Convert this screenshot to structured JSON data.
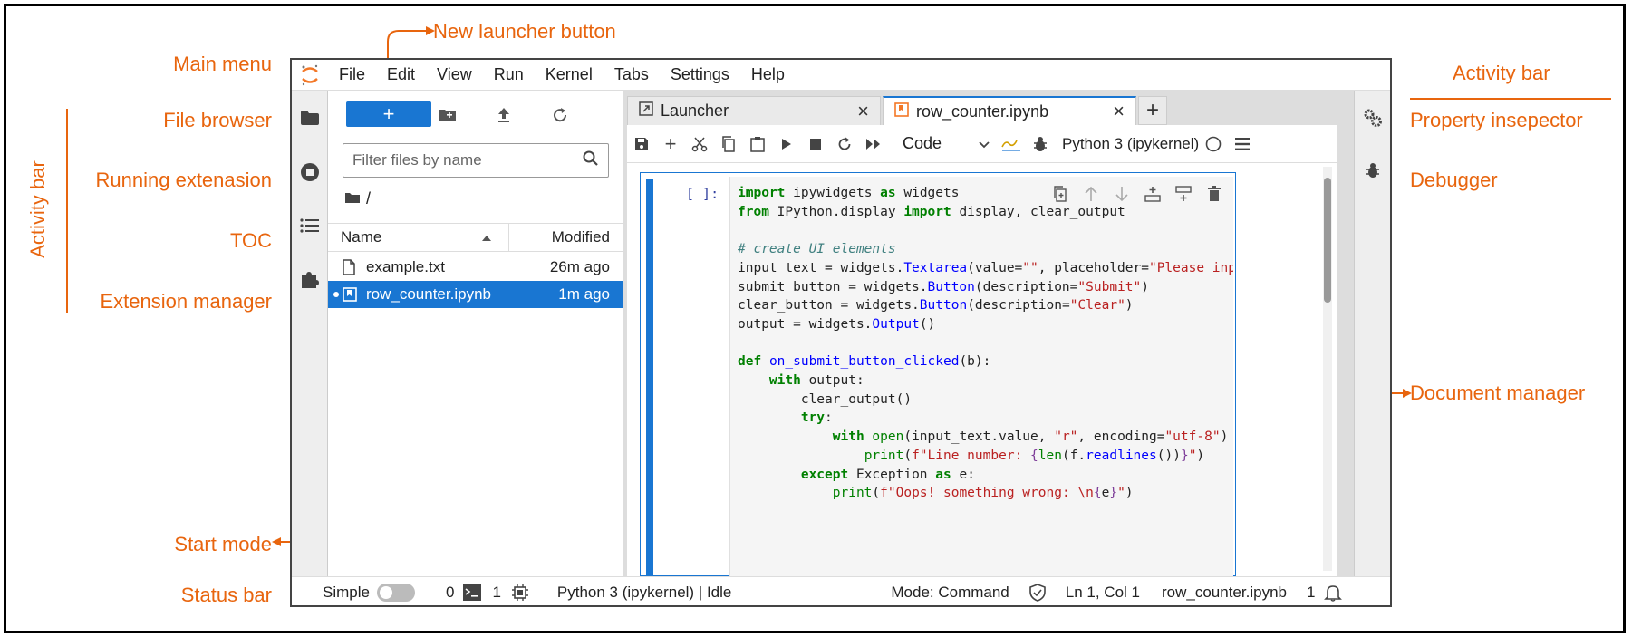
{
  "annotations": {
    "main_menu": "Main menu",
    "file_browser": "File browser",
    "running_extension": "Running extenasion",
    "toc": "TOC",
    "extension_manager": "Extension manager",
    "activity_bar_left": "Activity bar",
    "new_launcher": "New launcher button",
    "start_mode": "Start mode",
    "status_bar": "Status bar",
    "activity_bar_right": "Activity bar",
    "property_inspector": "Property insepector",
    "debugger": "Debugger",
    "document_manager": "Document manager"
  },
  "colors": {
    "annotation": "#e8650e",
    "accent": "#1976d2"
  },
  "menu": [
    "File",
    "Edit",
    "View",
    "Run",
    "Kernel",
    "Tabs",
    "Settings",
    "Help"
  ],
  "file_browser": {
    "new_label": "+",
    "filter_placeholder": "Filter files by name",
    "breadcrumb": "/",
    "col_name": "Name",
    "col_modified": "Modified",
    "files": [
      {
        "name": "example.txt",
        "modified": "26m ago",
        "icon": "file-icon"
      },
      {
        "name": "row_counter.ipynb",
        "modified": "1m ago",
        "icon": "notebook-icon"
      }
    ]
  },
  "tabs": {
    "launcher": "Launcher",
    "notebook": "row_counter.ipynb",
    "add": "+"
  },
  "notebook_toolbar": {
    "cell_type": "Code",
    "kernel": "Python 3 (ipykernel)"
  },
  "cell": {
    "prompt": "[ ]:"
  },
  "status": {
    "mode_label": "Simple",
    "terminals": "0",
    "kernels": "1",
    "kernel_status": "Python 3 (ipykernel) | Idle",
    "mode": "Mode: Command",
    "cursor": "Ln 1, Col 1",
    "file": "row_counter.ipynb",
    "notifications": "1"
  }
}
